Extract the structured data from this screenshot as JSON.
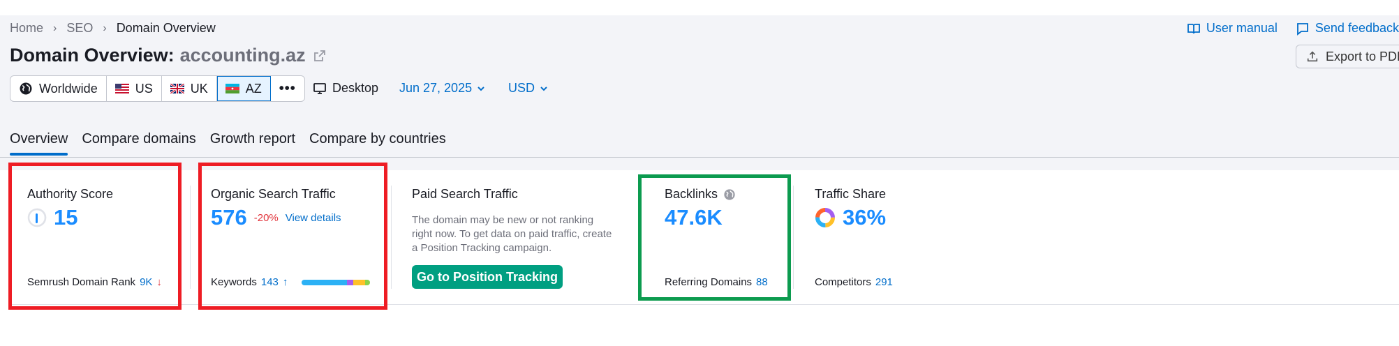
{
  "breadcrumb": {
    "items": [
      "Home",
      "SEO"
    ],
    "current": "Domain Overview"
  },
  "top_links": {
    "manual": "User manual",
    "feedback": "Send feedback"
  },
  "header": {
    "title_prefix": "Domain Overview:",
    "domain": "accounting.az",
    "export_label": "Export to PDF"
  },
  "databases": [
    {
      "label": "Worldwide",
      "icon": "globe-icon",
      "active": false
    },
    {
      "label": "US",
      "icon": "us-flag-icon",
      "active": false
    },
    {
      "label": "UK",
      "icon": "uk-flag-icon",
      "active": false
    },
    {
      "label": "AZ",
      "icon": "az-flag-icon",
      "active": true
    }
  ],
  "more_label": "•••",
  "device": {
    "label": "Desktop",
    "icon": "desktop-icon"
  },
  "date": {
    "label": "Jun 27, 2025"
  },
  "currency": {
    "label": "USD"
  },
  "tabs": [
    {
      "label": "Overview",
      "active": true
    },
    {
      "label": "Compare domains",
      "active": false
    },
    {
      "label": "Growth report",
      "active": false
    },
    {
      "label": "Compare by countries",
      "active": false
    }
  ],
  "cards": {
    "authority": {
      "title": "Authority Score",
      "value": "15",
      "foot_label": "Semrush Domain Rank",
      "foot_value": "9K",
      "trend": "↓"
    },
    "organic": {
      "title": "Organic Search Traffic",
      "value": "576",
      "delta": "-20%",
      "link": "View details",
      "foot_label": "Keywords",
      "foot_value": "143",
      "trend": "↑"
    },
    "paid": {
      "title": "Paid Search Traffic",
      "text": "The domain may be new or not ranking right now. To get data on paid traffic, create a Position Tracking campaign.",
      "button": "Go to Position Tracking"
    },
    "backlinks": {
      "title": "Backlinks",
      "value": "47.6K",
      "foot_label": "Referring Domains",
      "foot_value": "88"
    },
    "traffic_share": {
      "title": "Traffic Share",
      "value": "36%",
      "foot_label": "Competitors",
      "foot_value": "291"
    }
  },
  "colors": {
    "accent": "#006dca",
    "value_blue": "#1a8cff",
    "negative": "#e2363d",
    "green_button": "#009f81",
    "highlight_red": "#ee1c24",
    "highlight_green": "#0c9b4f"
  }
}
